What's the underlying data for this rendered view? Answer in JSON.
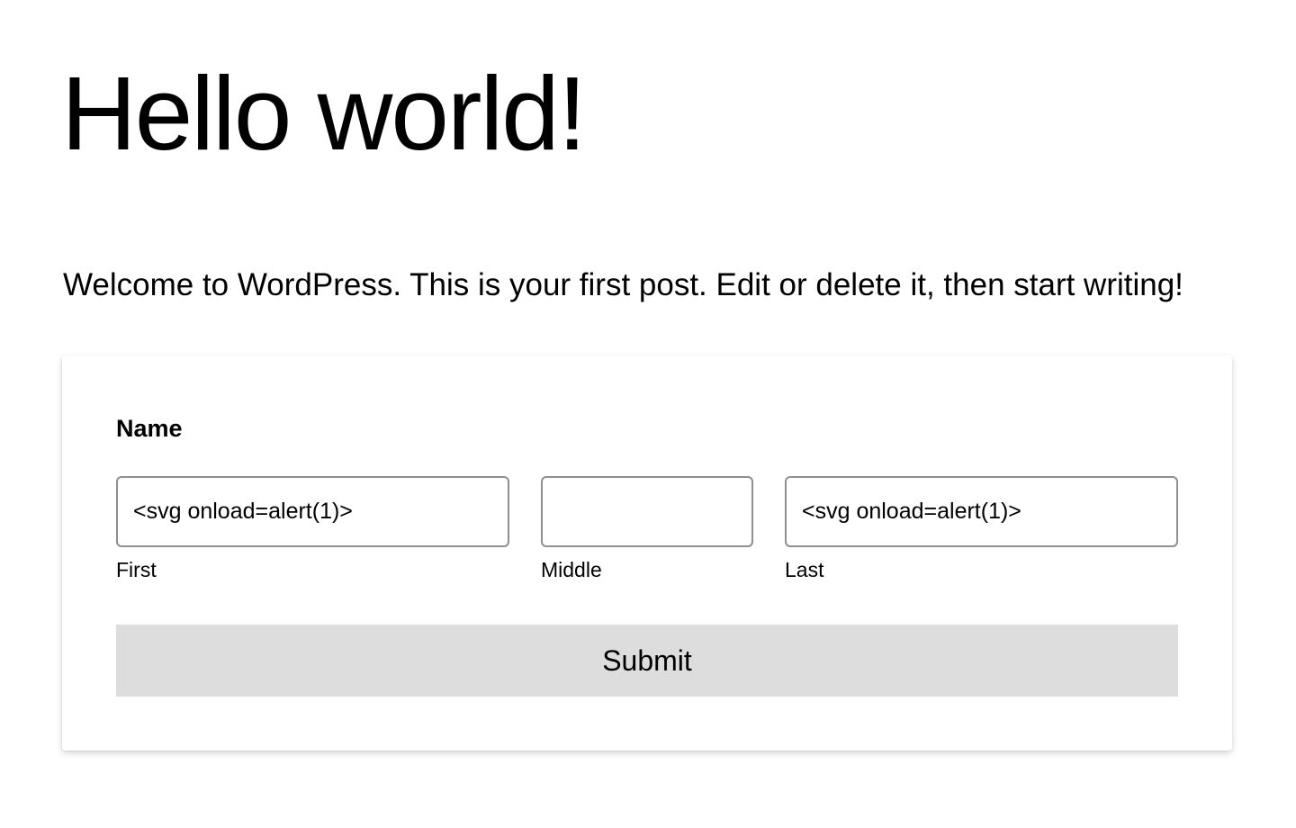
{
  "post": {
    "title": "Hello world!",
    "content": "Welcome to WordPress. This is your first post. Edit or delete it, then start writing!"
  },
  "form": {
    "field_label": "Name",
    "first": {
      "value": "<svg onload=alert(1)>",
      "label": "First"
    },
    "middle": {
      "value": "",
      "label": "Middle"
    },
    "last": {
      "value": "<svg onload=alert(1)>",
      "label": "Last"
    },
    "submit_label": "Submit"
  },
  "colors": {
    "input_border": "#8c8f94",
    "button_bg": "#dddddd",
    "text": "#000000",
    "background": "#ffffff"
  }
}
